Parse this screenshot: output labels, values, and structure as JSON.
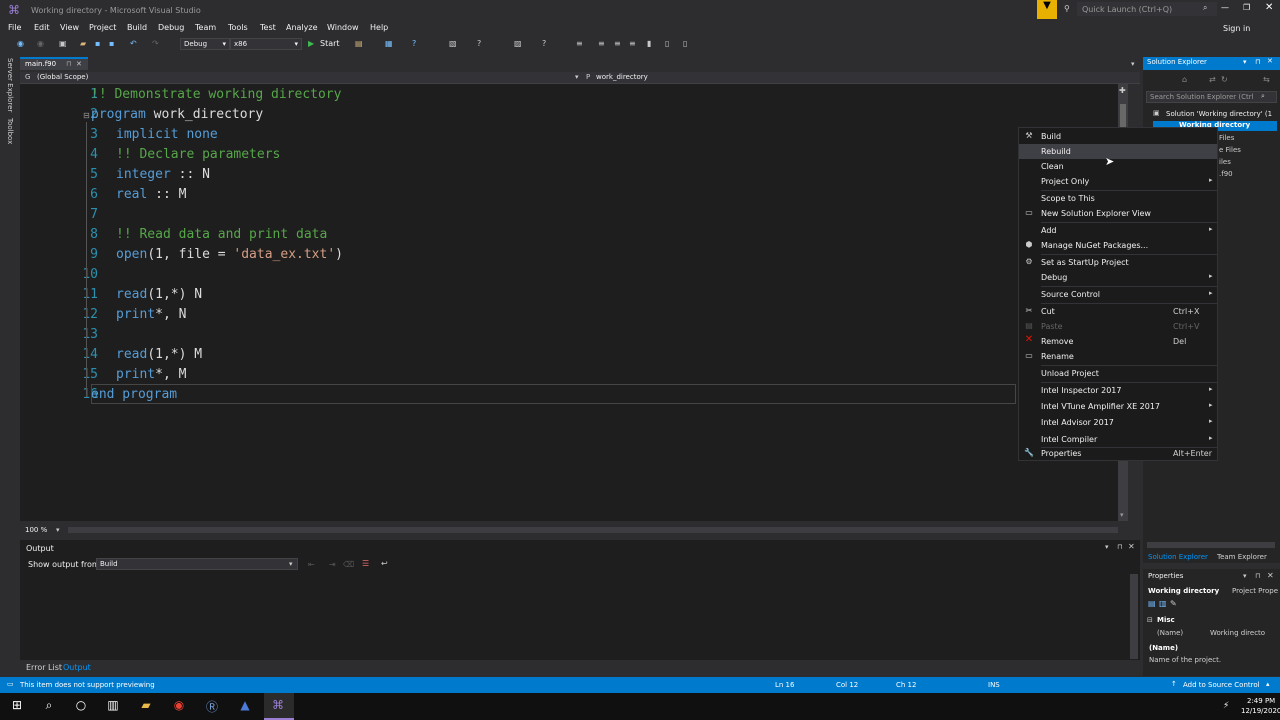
{
  "window": {
    "title": "Working directory - Microsoft Visual Studio",
    "quick_launch": "Quick Launch (Ctrl+Q)",
    "sign_in": "Sign in"
  },
  "menu": [
    "File",
    "Edit",
    "View",
    "Project",
    "Build",
    "Debug",
    "Team",
    "Tools",
    "Test",
    "Analyze",
    "Window",
    "Help"
  ],
  "toolbar": {
    "config": "Debug",
    "platform": "x86",
    "start": "Start"
  },
  "left_strip": {
    "server_explorer": "Server Explorer",
    "toolbox": "Toolbox"
  },
  "editor": {
    "tab": "main.f90",
    "scope": "(Global Scope)",
    "nav_right": "work_directory",
    "zoom": "100 %",
    "lines": [
      "1",
      "2",
      "3",
      "4",
      "5",
      "6",
      "7",
      "8",
      "9",
      "10",
      "11",
      "12",
      "13",
      "14",
      "15",
      "16"
    ],
    "code": {
      "l1": "!! Demonstrate working directory",
      "l2a": "program",
      "l2b": " work_directory",
      "l3": "implicit none",
      "l4": "!! Declare parameters",
      "l5a": "integer",
      "l5b": " :: N",
      "l6a": "real",
      "l6b": " :: M",
      "l8": "!! Read data and print data",
      "l9a": "open",
      "l9b": "(1, file = ",
      "l9c": "'data_ex.txt'",
      "l9d": ")",
      "l11a": "read",
      "l11b": "(1,*) N",
      "l12a": "print",
      "l12b": "*, N",
      "l14a": "read",
      "l14b": "(1,*) M",
      "l15a": "print",
      "l15b": "*, M",
      "l16": "end program"
    }
  },
  "output": {
    "title": "Output",
    "show_from_label": "Show output from:",
    "source": "Build"
  },
  "bottom_tabs": {
    "error_list": "Error List",
    "output": "Output"
  },
  "solution_explorer": {
    "title": "Solution Explorer",
    "search_placeholder": "Search Solution Explorer (Ctrl",
    "solution": "Solution 'Working directory' (1",
    "project": "Working directory",
    "frag1": "Files",
    "frag2": "e Files",
    "frag3": "iles",
    "frag4": ".f90",
    "tab_se": "Solution Explorer",
    "tab_te": "Team Explorer"
  },
  "properties": {
    "title": "Properties",
    "object": "Working directory",
    "object_type": "Project Prope",
    "category": "Misc",
    "prop_name": "(Name)",
    "prop_value": "Working directo",
    "desc_title": "(Name)",
    "desc": "Name of the project."
  },
  "context_menu": {
    "build": "Build",
    "rebuild": "Rebuild",
    "clean": "Clean",
    "project_only": "Project Only",
    "scope": "Scope to This",
    "new_view": "New Solution Explorer View",
    "add": "Add",
    "nuget": "Manage NuGet Packages...",
    "startup": "Set as StartUp Project",
    "debug": "Debug",
    "source_control": "Source Control",
    "cut": "Cut",
    "cut_sc": "Ctrl+X",
    "paste": "Paste",
    "paste_sc": "Ctrl+V",
    "remove": "Remove",
    "remove_sc": "Del",
    "rename": "Rename",
    "unload": "Unload Project",
    "inspector": "Intel Inspector 2017",
    "vtune": "Intel VTune Amplifier XE 2017",
    "advisor": "Intel Advisor 2017",
    "compiler": "Intel Compiler",
    "properties": "Properties",
    "properties_sc": "Alt+Enter"
  },
  "status": {
    "message": "This item does not support previewing",
    "ln": "Ln 16",
    "col": "Col 12",
    "ch": "Ch 12",
    "mode": "INS",
    "source_control": "Add to Source Control"
  },
  "taskbar": {
    "time": "2:49 PM",
    "date": "12/19/2020"
  }
}
